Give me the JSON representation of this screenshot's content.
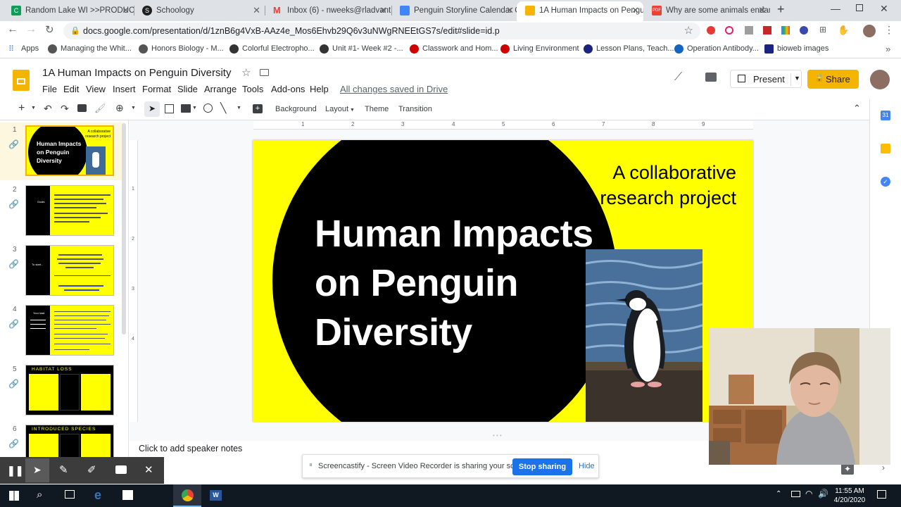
{
  "browser": {
    "tabs": [
      {
        "title": "Random Lake WI >>PRODUC",
        "color": "#0f9d58",
        "letter": "C"
      },
      {
        "title": "Schoology",
        "color": "#1f1f1f",
        "letter": "S"
      },
      {
        "title": "Inbox (6) - nweeks@rladvant",
        "color": "#ea4335",
        "letter": "M"
      },
      {
        "title": "Penguin Storyline Calendar C",
        "color": "#4285f4",
        "letter": ""
      },
      {
        "title": "1A Human Impacts on Pengu",
        "color": "#f4b400",
        "letter": ""
      },
      {
        "title": "Why are some animals endan",
        "color": "#ea4335",
        "letter": "PDF"
      }
    ],
    "url": "docs.google.com/presentation/d/1znB6g4VxB-AAz4e_Mos6Ehvb29Q6v3uNWgRNEEtGS7s/edit#slide=id.p",
    "bookmarks": [
      {
        "label": "Apps",
        "color": "#4285f4"
      },
      {
        "label": "Managing the Whit...",
        "color": "#555"
      },
      {
        "label": "Honors Biology - M...",
        "color": "#555"
      },
      {
        "label": "Colorful Electropho...",
        "color": "#333"
      },
      {
        "label": "Unit #1- Week #2 -...",
        "color": "#333"
      },
      {
        "label": "Classwork and Hom...",
        "color": "#c00"
      },
      {
        "label": "Living Environment",
        "color": "#c00"
      },
      {
        "label": "Lesson Plans, Teach...",
        "color": "#1a237e"
      },
      {
        "label": "Operation Antibody...",
        "color": "#1565c0"
      },
      {
        "label": "bioweb images",
        "color": "#1a237e"
      }
    ]
  },
  "doc": {
    "title": "1A Human Impacts on Penguin Diversity",
    "menus": [
      "File",
      "Edit",
      "View",
      "Insert",
      "Format",
      "Slide",
      "Arrange",
      "Tools",
      "Add-ons",
      "Help"
    ],
    "save_status": "All changes saved in Drive",
    "present_label": "Present",
    "share_label": "Share",
    "toolbar": {
      "background": "Background",
      "layout": "Layout",
      "theme": "Theme",
      "transition": "Transition"
    }
  },
  "ruler": [
    "1",
    "2",
    "3",
    "4",
    "5",
    "6",
    "7",
    "8",
    "9"
  ],
  "vruler": [
    "1",
    "2",
    "3",
    "4"
  ],
  "slides": [
    {
      "num": "1",
      "title": "Human Impacts on Penguin Diversity",
      "sub": "A collaborative research project"
    },
    {
      "num": "2",
      "side": "Goals"
    },
    {
      "num": "3",
      "side": "To start..."
    },
    {
      "num": "4",
      "side": "Your task"
    },
    {
      "num": "5",
      "header": "Habitat Loss"
    },
    {
      "num": "6",
      "header": "Introduced Species"
    }
  ],
  "slide": {
    "title": "Human Impacts on Penguin Diversity",
    "subtitle": "A collaborative research project"
  },
  "notes_placeholder": "Click to add speaker notes",
  "screencastify": {
    "message": "Screencastify - Screen Video Recorder is sharing your screen.",
    "stop_label": "Stop sharing",
    "hide_label": "Hide"
  },
  "taskbar": {
    "time": "11:55 AM",
    "date": "4/20/2020"
  }
}
